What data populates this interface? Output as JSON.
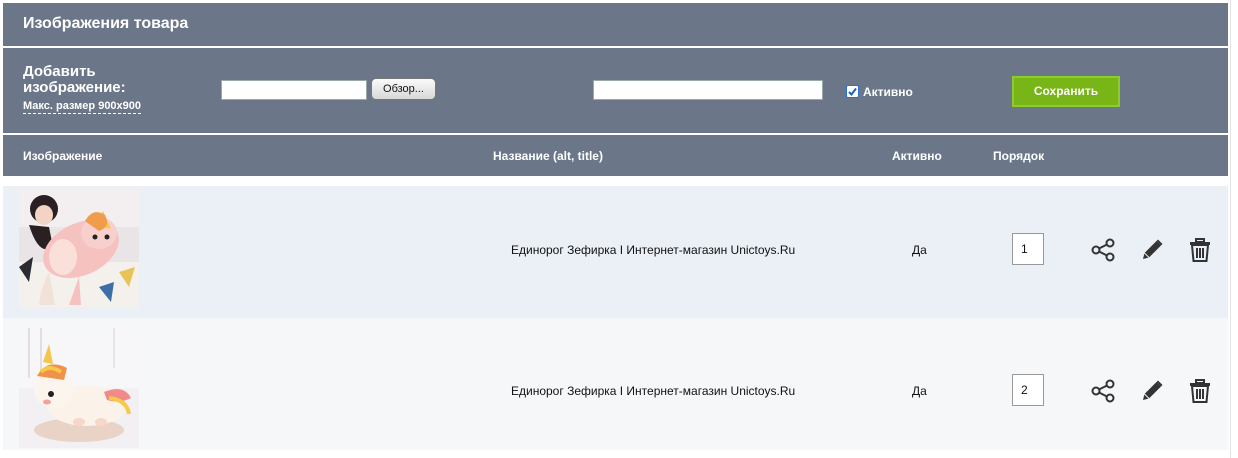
{
  "header": {
    "title": "Изображения товара"
  },
  "add_image": {
    "label": "Добавить изображение:",
    "hint": "Макс. размер 900x900",
    "file_value": "",
    "browse_label": "Обзор...",
    "alt_value": "",
    "active_checked": true,
    "active_label": "Активно",
    "save_label": "Сохранить"
  },
  "table": {
    "columns": {
      "image": "Изображение",
      "name": "Название (alt, title)",
      "active": "Активно",
      "order": "Порядок"
    },
    "rows": [
      {
        "name": "Единорог Зефирка I Интернет-магазин Unictoys.Ru",
        "active": "Да",
        "order": "1",
        "image": "plush-unicorn-with-woman-photo"
      },
      {
        "name": "Единорог Зефирка I Интернет-магазин Unictoys.Ru",
        "active": "Да",
        "order": "2",
        "image": "plush-unicorn-lying-photo"
      }
    ],
    "row_icons": [
      "share-icon",
      "edit-pencil-icon",
      "trash-icon"
    ]
  },
  "colors": {
    "header_bg": "#6b7789",
    "row_odd_bg": "#ebeff6",
    "row_even_bg": "#f6f7f9",
    "save_button": "#78b516"
  }
}
